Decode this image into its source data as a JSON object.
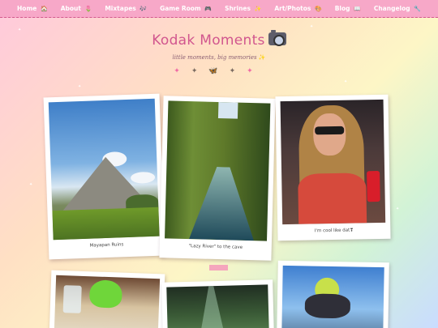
{
  "nav": {
    "items": [
      {
        "label": "Home",
        "icon": "🏠"
      },
      {
        "label": "About",
        "icon": "🌷"
      },
      {
        "label": "Mixtapes",
        "icon": "🎶"
      },
      {
        "label": "Game Room",
        "icon": "🎮"
      },
      {
        "label": "Shrines",
        "icon": "✨"
      },
      {
        "label": "Art/Photos",
        "icon": "🎨"
      },
      {
        "label": "Blog",
        "icon": "📖"
      },
      {
        "label": "Changelog",
        "icon": "🔧"
      }
    ]
  },
  "header": {
    "title": "Kodak Moments",
    "title_icon": "camera-with-flash",
    "subtitle": "little moments, big memories",
    "subtitle_sparkle": "✨",
    "decoration": [
      "✦",
      "✦",
      "🦋",
      "✦",
      "✦"
    ]
  },
  "photos": [
    {
      "caption": "Mayapan Ruins",
      "subject": "stepped stone pyramid under blue sky"
    },
    {
      "caption": "\"Lazy River\" to the cave",
      "subject": "green jungle river canal"
    },
    {
      "caption": "I'm cool like dat❣",
      "subject": "woman in sunglasses holding red can"
    },
    {
      "caption": "",
      "subject": "drinks on restaurant table"
    },
    {
      "caption": "",
      "subject": "dark cenote cave"
    },
    {
      "caption": "",
      "subject": "tandem skydivers"
    }
  ],
  "colors": {
    "nav_bg": "#f7a8c8",
    "title": "#d1568e",
    "bg_start": "#ffc9dc",
    "bg_end": "#c9dcff"
  }
}
